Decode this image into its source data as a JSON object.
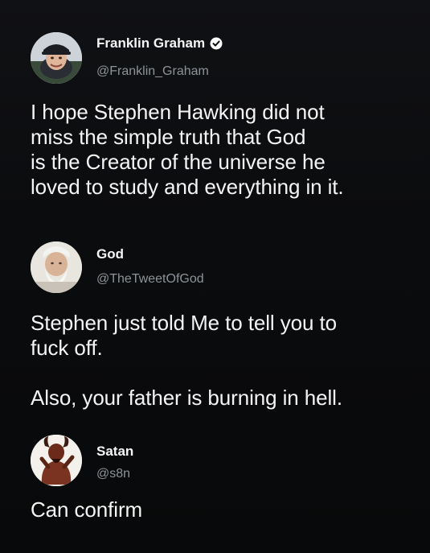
{
  "tweets": [
    {
      "name": "Franklin Graham",
      "handle": "@Franklin_Graham",
      "verified": true,
      "avatar": "franklin-graham-photo",
      "lines": [
        "I hope Stephen Hawking did not",
        "miss the simple truth that God",
        "is the Creator of the universe he",
        "loved to study and everything in it."
      ]
    },
    {
      "name": "God",
      "handle": "@TheTweetOfGod",
      "verified": false,
      "avatar": "bearded-old-man-photo",
      "lines": [
        "Stephen just told Me to tell you to",
        "fuck off."
      ],
      "lines2": [
        "Also, your father is burning in hell."
      ]
    },
    {
      "name": "Satan",
      "handle": "@s8n",
      "verified": false,
      "avatar": "horned-devil-figure",
      "lines": [
        "Can confirm"
      ]
    }
  ],
  "colors": {
    "background": "#0a0b0d",
    "text": "#f4f4f4",
    "handle": "#8e9398",
    "verified_badge": "#ffffff"
  }
}
